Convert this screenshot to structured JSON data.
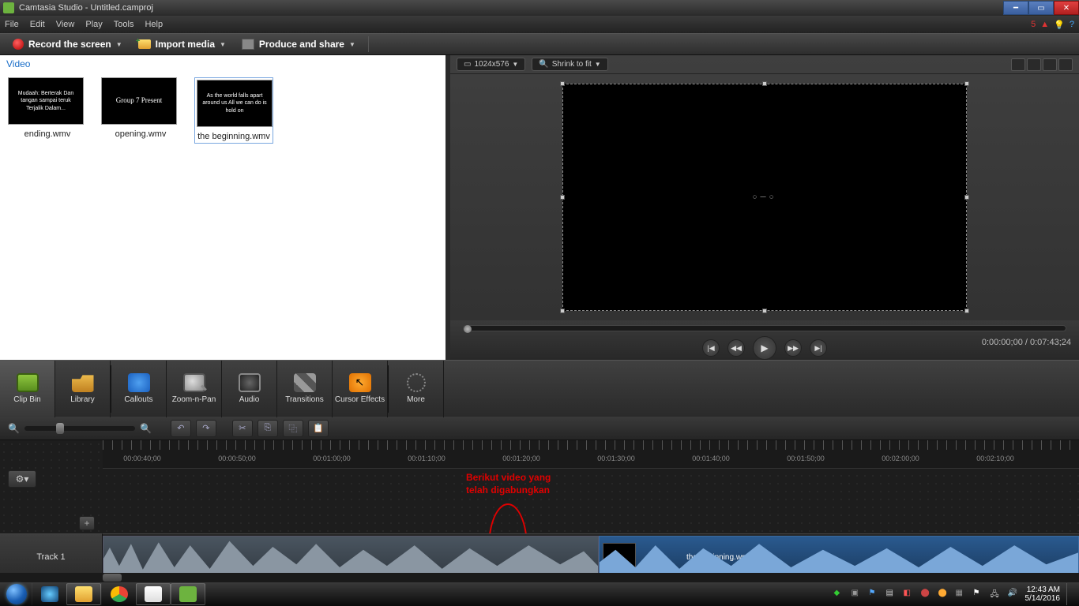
{
  "window": {
    "title": "Camtasia Studio - Untitled.camproj",
    "notif_count": "5"
  },
  "menu": [
    "File",
    "Edit",
    "View",
    "Play",
    "Tools",
    "Help"
  ],
  "toolbar": {
    "record": "Record the screen",
    "import": "Import media",
    "produce": "Produce and share"
  },
  "clipbin": {
    "heading": "Video",
    "clips": [
      {
        "name": "ending.wmv",
        "caption": "Mudaah: Berterak Dan tangan sampai teruk Terjalik Dalam..."
      },
      {
        "name": "opening.wmv",
        "caption": "Group 7\nPresent"
      },
      {
        "name": "the beginning.wmv",
        "caption": "As the world falls apart around us\nAll we can do is hold on"
      }
    ]
  },
  "preview": {
    "dimensions": "1024x576",
    "fit": "Shrink to fit",
    "timecode": "0:00:00;00 / 0:07:43;24"
  },
  "tabs": [
    "Clip Bin",
    "Library",
    "Callouts",
    "Zoom-n-Pan",
    "Audio",
    "Transitions",
    "Cursor Effects",
    "More"
  ],
  "timeline": {
    "ticks": [
      "00:00:40;00",
      "00:00:50;00",
      "00:01:00;00",
      "00:01:10;00",
      "00:01:20;00",
      "00:01:30;00",
      "00:01:40;00",
      "00:01:50;00",
      "00:02:00;00",
      "00:02:10;00"
    ],
    "track_name": "Track 1",
    "clip2_label": "the beginning.wmv"
  },
  "annotation": {
    "line1": "Berikut video yang",
    "line2": "telah digabungkan"
  },
  "playback_timecode_small": "0:00:00;00 / 0:07:43;24",
  "systray": {
    "time": "12:43 AM",
    "date": "5/14/2016"
  }
}
